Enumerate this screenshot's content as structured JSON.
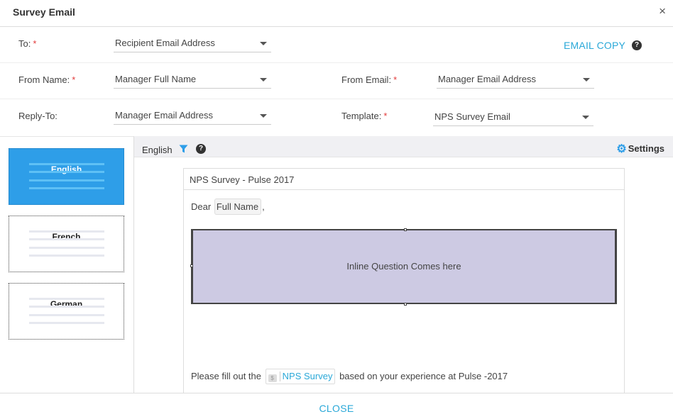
{
  "dialog": {
    "title": "Survey Email",
    "close_icon": "×"
  },
  "form": {
    "to": {
      "label": "To:",
      "value": "Recipient Email Address"
    },
    "from_name": {
      "label": "From Name:",
      "value": "Manager Full Name"
    },
    "from_email": {
      "label": "From Email:",
      "value": "Manager Email Address"
    },
    "reply_to": {
      "label": "Reply-To:",
      "value": "Manager Email Address"
    },
    "template": {
      "label": "Template:",
      "value": "NPS Survey Email"
    },
    "required_mark": "*",
    "email_copy": "EMAIL COPY",
    "help_glyph": "?"
  },
  "languages": [
    {
      "name": "English",
      "active": true
    },
    {
      "name": "French",
      "active": false
    },
    {
      "name": "German",
      "active": false
    }
  ],
  "editor": {
    "current_language": "English",
    "settings_label": "Settings",
    "subject": "NPS Survey - Pulse 2017",
    "dear_prefix": "Dear",
    "name_token": "Full Name",
    "dear_suffix": ",",
    "inline_question": "Inline Question Comes here",
    "fill_prefix": "Please fill out the",
    "survey_token": "NPS Survey",
    "fill_suffix": "based on your experience at Pulse -2017"
  },
  "footer": {
    "close_label": "CLOSE"
  },
  "colors": {
    "accent": "#2aa8d8",
    "active_card": "#2e9ee8",
    "inline_bg": "#cdcae3",
    "required": "#e23b3b"
  }
}
